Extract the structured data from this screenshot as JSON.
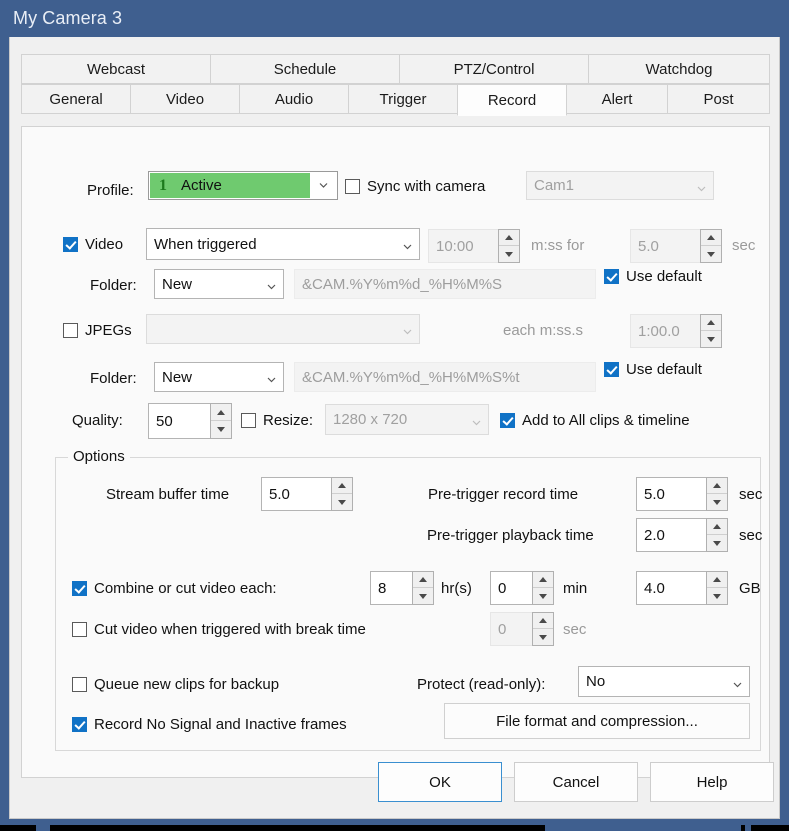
{
  "window": {
    "title": "My Camera 3"
  },
  "tabs": {
    "top_row": [
      {
        "label": "Webcast",
        "selected": false
      },
      {
        "label": "Schedule",
        "selected": false
      },
      {
        "label": "PTZ/Control",
        "selected": false
      },
      {
        "label": "Watchdog",
        "selected": false
      }
    ],
    "bottom_row": [
      {
        "label": "General",
        "selected": false
      },
      {
        "label": "Video",
        "selected": false
      },
      {
        "label": "Audio",
        "selected": false
      },
      {
        "label": "Trigger",
        "selected": false
      },
      {
        "label": "Record",
        "selected": true
      },
      {
        "label": "Alert",
        "selected": false
      },
      {
        "label": "Post",
        "selected": false
      }
    ]
  },
  "record": {
    "profile_label": "Profile:",
    "profile_number": "1",
    "profile_value": "Active",
    "sync_with_camera": {
      "label": "Sync with camera",
      "checked": false
    },
    "camera_select": {
      "value": "Cam1",
      "enabled": false
    },
    "video": {
      "label": "Video",
      "checked": true
    },
    "video_mode": {
      "value": "When triggered"
    },
    "video_duration": {
      "value": "10:00",
      "enabled": false
    },
    "video_units_1": "m:ss for",
    "video_for": {
      "value": "5.0",
      "enabled": false
    },
    "video_units_2": "sec",
    "video_folder_label": "Folder:",
    "video_folder_mode": {
      "value": "New"
    },
    "video_folder_path": {
      "value": "&CAM.%Y%m%d_%H%M%S",
      "enabled": false
    },
    "video_use_default": {
      "label": "Use default",
      "checked": true
    },
    "jpegs": {
      "label": "JPEGs",
      "checked": false
    },
    "jpegs_mode": {
      "value": "",
      "enabled": false
    },
    "jpegs_units": "each m:ss.s",
    "jpegs_interval": {
      "value": "1:00.0",
      "enabled": false
    },
    "jpegs_folder_label": "Folder:",
    "jpegs_folder_mode": {
      "value": "New"
    },
    "jpegs_folder_path": {
      "value": "&CAM.%Y%m%d_%H%M%S%t",
      "enabled": false
    },
    "jpegs_use_default": {
      "label": "Use default",
      "checked": true
    },
    "quality_label": "Quality:",
    "quality_value": "50",
    "resize": {
      "label": "Resize:",
      "checked": false
    },
    "resize_value": {
      "value": "1280 x 720",
      "enabled": false
    },
    "add_clips": {
      "label": "Add  to All clips & timeline",
      "checked": true
    }
  },
  "options": {
    "title": "Options",
    "stream_buffer_label": "Stream buffer time",
    "stream_buffer_value": "5.0",
    "pretrigger_record_label": "Pre-trigger record time",
    "pretrigger_record_value": "5.0",
    "pretrigger_record_unit": "sec",
    "pretrigger_playback_label": "Pre-trigger playback time",
    "pretrigger_playback_value": "2.0",
    "pretrigger_playback_unit": "sec",
    "combine": {
      "label": "Combine or cut video each:",
      "checked": true
    },
    "combine_hours": "8",
    "combine_hours_unit": "hr(s)",
    "combine_min": "0",
    "combine_min_unit": "min",
    "combine_gb": "4.0",
    "combine_gb_unit": "GB",
    "cut_on_trigger": {
      "label": "Cut video when triggered with break time",
      "checked": false
    },
    "cut_break_value": "0",
    "cut_break_unit": "sec",
    "queue_backup": {
      "label": "Queue new clips for backup",
      "checked": false
    },
    "protect_label": "Protect (read-only):",
    "protect_value": "No",
    "record_no_signal": {
      "label": "Record No Signal and Inactive frames",
      "checked": true
    },
    "file_format_button": "File format and compression..."
  },
  "footer": {
    "ok": "OK",
    "cancel": "Cancel",
    "help": "Help"
  },
  "colors": {
    "window_frame": "#3f5f8f",
    "accent_check": "#1072c6",
    "profile_green": "#6fca6f",
    "default_button_border": "#3a8fd0"
  }
}
